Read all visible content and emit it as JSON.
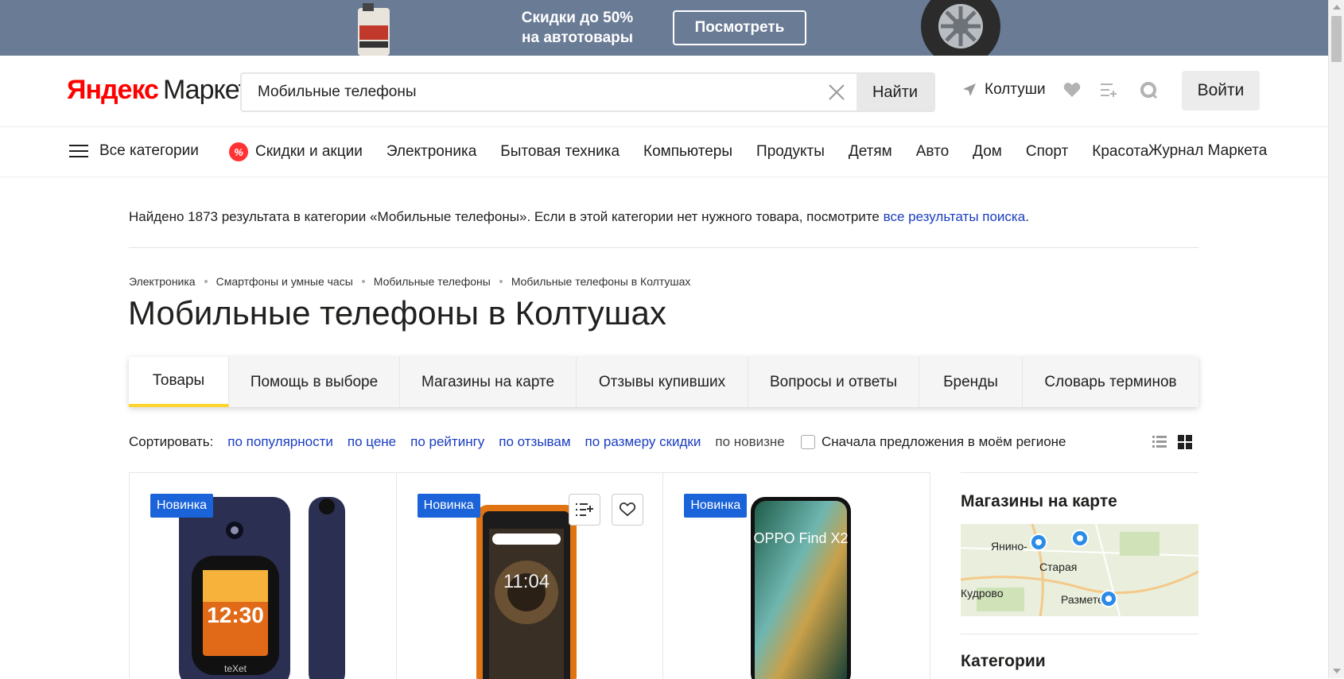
{
  "banner": {
    "promo_line1": "Скидки до 50%",
    "promo_line2": "на автотовары",
    "cta": "Посмотреть",
    "bg_color": "#6a7b96"
  },
  "header": {
    "logo_brand": "Яндекс",
    "logo_product": "Маркет",
    "search_value": "Мобильные телефоны",
    "search_button": "Найти",
    "location": "Колтуши",
    "login": "Войти"
  },
  "nav": {
    "all_categories": "Все категории",
    "items": [
      "Скидки и акции",
      "Электроника",
      "Бытовая техника",
      "Компьютеры",
      "Продукты",
      "Детям",
      "Авто",
      "Дом",
      "Спорт",
      "Красота"
    ],
    "journal": "Журнал Маркета"
  },
  "found": {
    "text": "Найдено 1873 результата в категории «Мобильные телефоны». Если в этой категории нет нужного товара, посмотрите ",
    "link": "все результаты поиска",
    "end": "."
  },
  "breadcrumbs": [
    "Электроника",
    "Смартфоны и умные часы",
    "Мобильные телефоны",
    "Мобильные телефоны в Колтушах"
  ],
  "page_title": "Мобильные телефоны в Колтушах",
  "tabs": [
    "Товары",
    "Помощь в выборе",
    "Магазины на карте",
    "Отзывы купивших",
    "Вопросы и ответы",
    "Бренды",
    "Словарь терминов"
  ],
  "sort": {
    "label": "Сортировать:",
    "options": [
      "по популярности",
      "по цене",
      "по рейтингу",
      "по отзывам",
      "по размеру скидки",
      "по новизне"
    ],
    "region_checkbox": "Сначала предложения в моём регионе"
  },
  "products": [
    {
      "badge": "Новинка",
      "screen_time": "12:30",
      "brand_text": "teXet"
    },
    {
      "badge": "Новинка",
      "screen_time": "11:04"
    },
    {
      "badge": "Новинка",
      "screen_text": "OPPO Find X2"
    }
  ],
  "sidebar": {
    "map_title": "Магазины на карте",
    "map_labels": [
      "Янино-",
      "Старая",
      "Кудрово",
      "Размете"
    ],
    "categories_title": "Категории"
  },
  "colors": {
    "link": "#1a3dc1",
    "badge": "#1a63d8",
    "tab_accent": "#fed42b",
    "logo_red": "#ff0000"
  }
}
